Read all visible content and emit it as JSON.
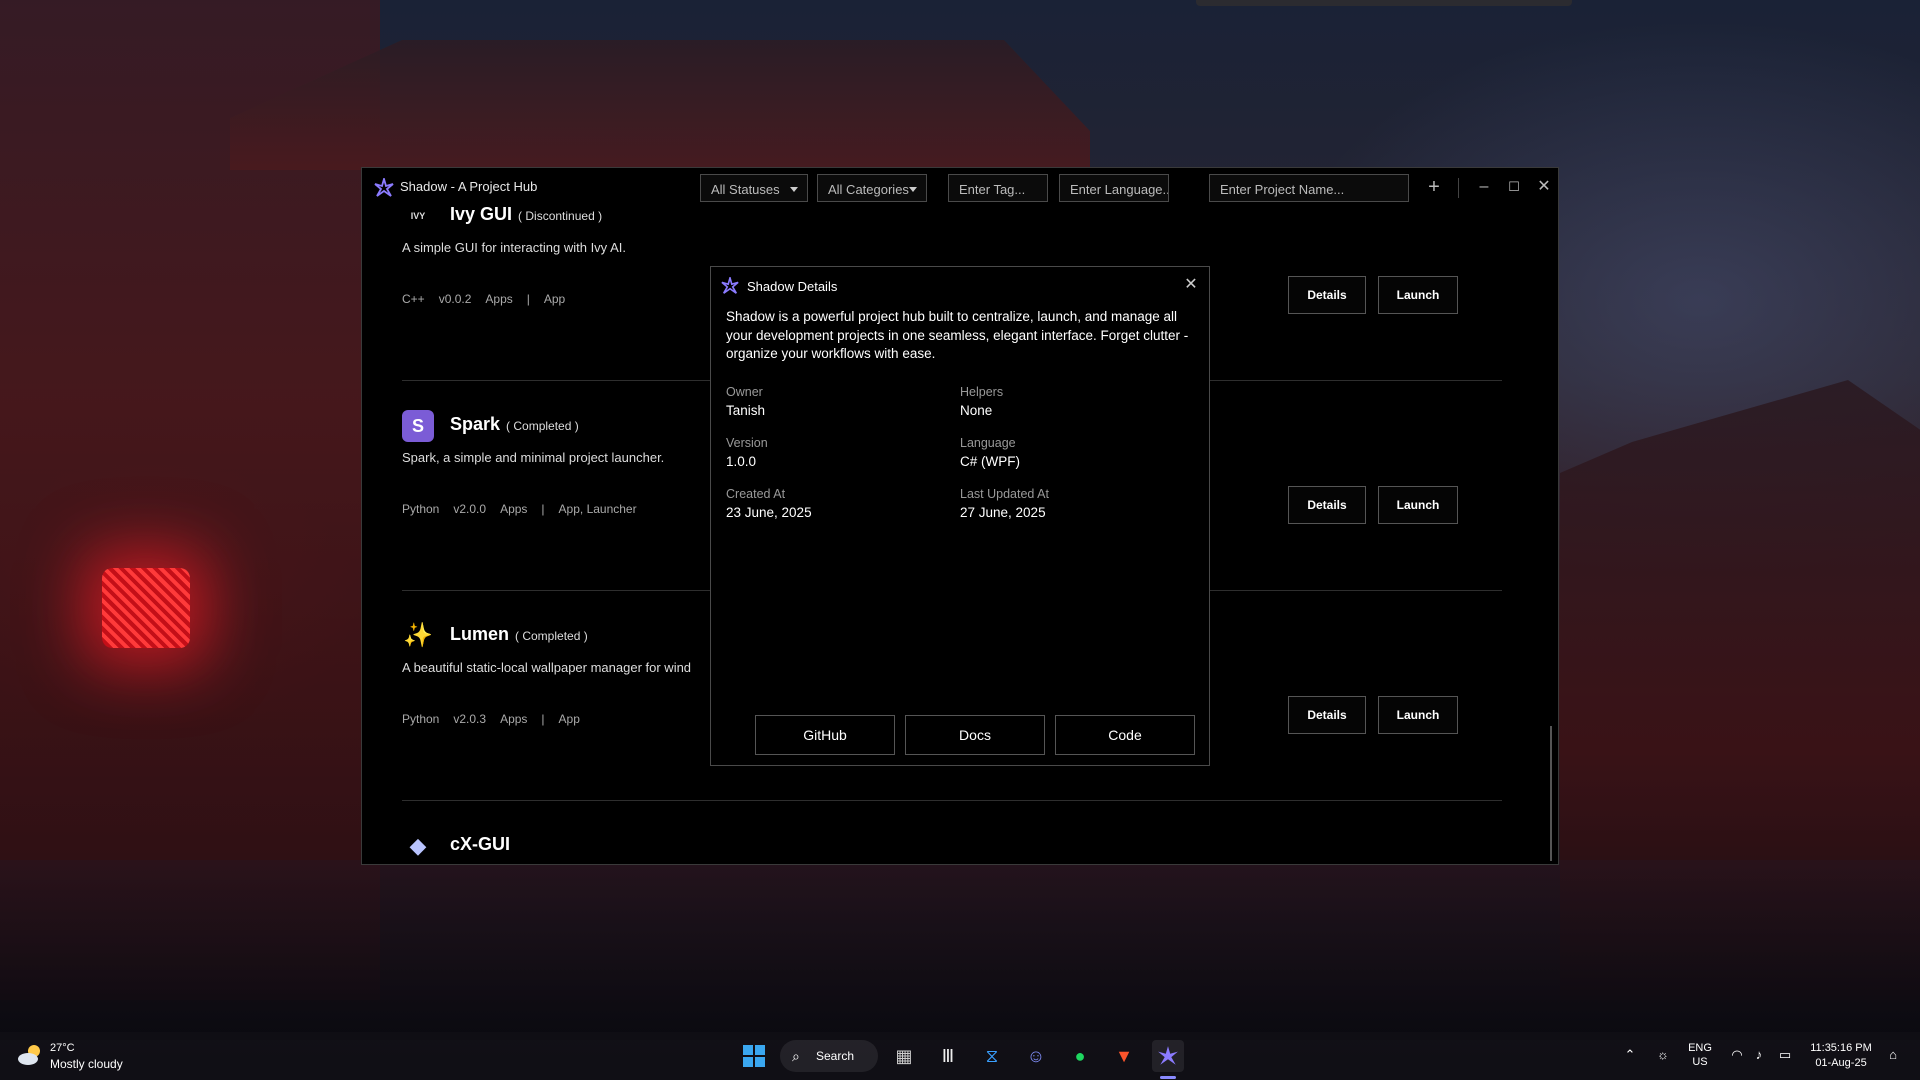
{
  "window": {
    "title": "Shadow - A Project Hub",
    "filters": {
      "status": "All Statuses",
      "category": "All Categories",
      "tag_placeholder": "Enter Tag...",
      "language_placeholder": "Enter Language...",
      "name_placeholder": "Enter Project Name..."
    },
    "icons": {
      "add": "plus-icon",
      "minimize": "minimize-icon",
      "maximize": "maximize-icon",
      "close": "close-icon"
    }
  },
  "projects": [
    {
      "icon_text": "IVY",
      "name": "Ivy GUI",
      "status": "( Discontinued )",
      "description": "A simple GUI for interacting with Ivy AI.",
      "language": "C++",
      "version": "v0.0.2",
      "category": "Apps",
      "separator": "|",
      "tags": "App",
      "details_label": "Details",
      "launch_label": "Launch"
    },
    {
      "icon_text": "S",
      "name": "Spark",
      "status": "( Completed )",
      "description": "Spark, a simple and minimal project launcher.",
      "language": "Python",
      "version": "v2.0.0",
      "category": "Apps",
      "separator": "|",
      "tags": "App, Launcher",
      "details_label": "Details",
      "launch_label": "Launch"
    },
    {
      "icon_text": "✨",
      "name": "Lumen",
      "status": "( Completed )",
      "description": "A beautiful static-local wallpaper manager for wind",
      "language": "Python",
      "version": "v2.0.3",
      "category": "Apps",
      "separator": "|",
      "tags": "App",
      "details_label": "Details",
      "launch_label": "Launch"
    },
    {
      "icon_text": "◆",
      "name": "cX-GUI",
      "status": "",
      "description": "",
      "language": "",
      "version": "",
      "category": "",
      "separator": "",
      "tags": "",
      "details_label": "",
      "launch_label": ""
    }
  ],
  "dialog": {
    "title": "Shadow Details",
    "description": "Shadow is a powerful project hub built to centralize, launch, and manage all your development projects in one seamless, elegant interface. Forget clutter - organize your workflows with ease.",
    "fields": {
      "owner_label": "Owner",
      "owner": "Tanish",
      "helpers_label": "Helpers",
      "helpers": "None",
      "version_label": "Version",
      "version": "1.0.0",
      "language_label": "Language",
      "language": "C# (WPF)",
      "created_label": "Created At",
      "created": "23 June, 2025",
      "updated_label": "Last Updated At",
      "updated": "27 June, 2025"
    },
    "buttons": {
      "github": "GitHub",
      "docs": "Docs",
      "code": "Code"
    }
  },
  "taskbar": {
    "weather": {
      "temp": "27°C",
      "desc": "Mostly cloudy",
      "icon": "cloud-sun-icon"
    },
    "search_label": "Search",
    "pinned": [
      "windows-start-icon",
      "search-icon",
      "file-explorer-icon",
      "app-icon",
      "vscode-icon",
      "discord-icon",
      "spotify-icon",
      "brave-icon",
      "shadow-app-icon"
    ],
    "tray": {
      "lang_top": "ENG",
      "lang_bottom": "US",
      "time": "11:35:16 PM",
      "date": "01-Aug-25"
    }
  },
  "colors": {
    "accent": "#7b6cff",
    "spark_icon_bg": "#7b5cd6",
    "lantern": "#ff2a2a"
  }
}
